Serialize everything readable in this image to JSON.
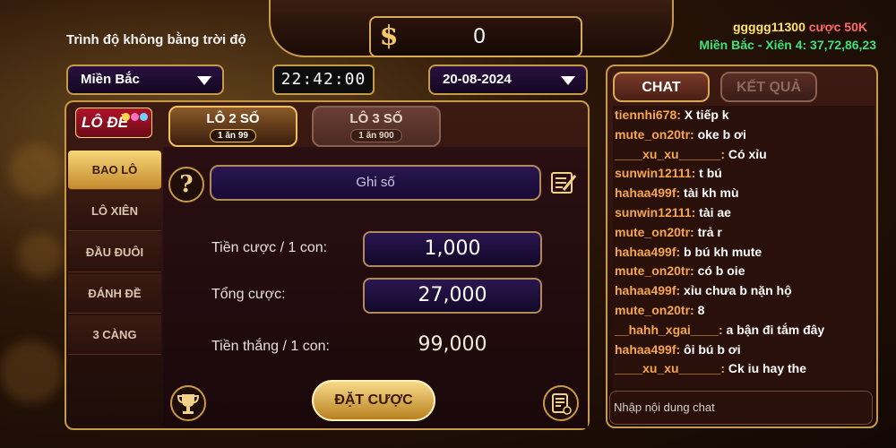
{
  "header": {
    "level_text": "Trình độ không bằng trời độ",
    "currency_symbol": "$",
    "coin_value": "0",
    "news_user": "ggggg11300",
    "news_bet": "cược 50K",
    "news_result": "Miền Bắc - Xiên 4: 37,72,86,23"
  },
  "selectors": {
    "region": "Miền Bắc",
    "time": "22:42:00",
    "date": "20-08-2024"
  },
  "logo": {
    "text": "LÔ ĐỀ"
  },
  "side_menu": [
    {
      "label": "BAO LÔ",
      "active": true
    },
    {
      "label": "LÔ XIÊN",
      "active": false
    },
    {
      "label": "ĐẦU ĐUÔI",
      "active": false
    },
    {
      "label": "ĐÁNH ĐỀ",
      "active": false
    },
    {
      "label": "3 CÀNG",
      "active": false
    }
  ],
  "tabs": [
    {
      "label": "LÔ 2 SỐ",
      "sub": "1 ăn 99",
      "active": true
    },
    {
      "label": "LÔ 3 SỐ",
      "sub": "1 ăn 900",
      "active": false
    }
  ],
  "form": {
    "help_symbol": "?",
    "number_placeholder": "Ghi số",
    "bet_per_label": "Tiền cược / 1 con:",
    "bet_per_value": "1,000",
    "total_label": "Tổng cược:",
    "total_value": "27,000",
    "win_label": "Tiền thắng / 1 con:",
    "win_value": "99,000",
    "bet_button": "ĐẶT CƯỢC"
  },
  "chat": {
    "tab_chat": "CHAT",
    "tab_result": "KẾT QUẢ",
    "input_placeholder": "Nhập nội dung chat",
    "messages": [
      {
        "user": "tiennhi678:",
        "text": " X tiếp k"
      },
      {
        "user": "mute_on20tr:",
        "text": " oke b ơi"
      },
      {
        "user": "____xu_xu______:",
        "text": " Có xỉu"
      },
      {
        "user": "sunwin12111:",
        "text": " t bú"
      },
      {
        "user": "hahaa499f:",
        "text": " tài kh mù"
      },
      {
        "user": "sunwin12111:",
        "text": " tài ae"
      },
      {
        "user": "mute_on20tr:",
        "text": " trả r"
      },
      {
        "user": "hahaa499f:",
        "text": " b bú kh mute"
      },
      {
        "user": "mute_on20tr:",
        "text": " có b oie"
      },
      {
        "user": "hahaa499f:",
        "text": " xỉu chưa b nặn hộ"
      },
      {
        "user": "mute_on20tr:",
        "text": " 8"
      },
      {
        "user": "__hahh_xgai____:",
        "text": " a bận đi tắm đây"
      },
      {
        "user": "hahaa499f:",
        "text": " ôi bú b ơi"
      },
      {
        "user": "____xu_xu______:",
        "text": " Ck iu hay the"
      }
    ]
  },
  "icons": {
    "dollar": "dollar-icon",
    "help": "help-icon",
    "edit": "edit-icon",
    "trophy": "trophy-icon",
    "history": "history-icon"
  },
  "colors": {
    "gold_border": "#c79a48",
    "username": "#f6a64a",
    "news_result": "#3ee27a",
    "news_user": "#ffe36b",
    "news_bet": "#ff6b6b"
  }
}
